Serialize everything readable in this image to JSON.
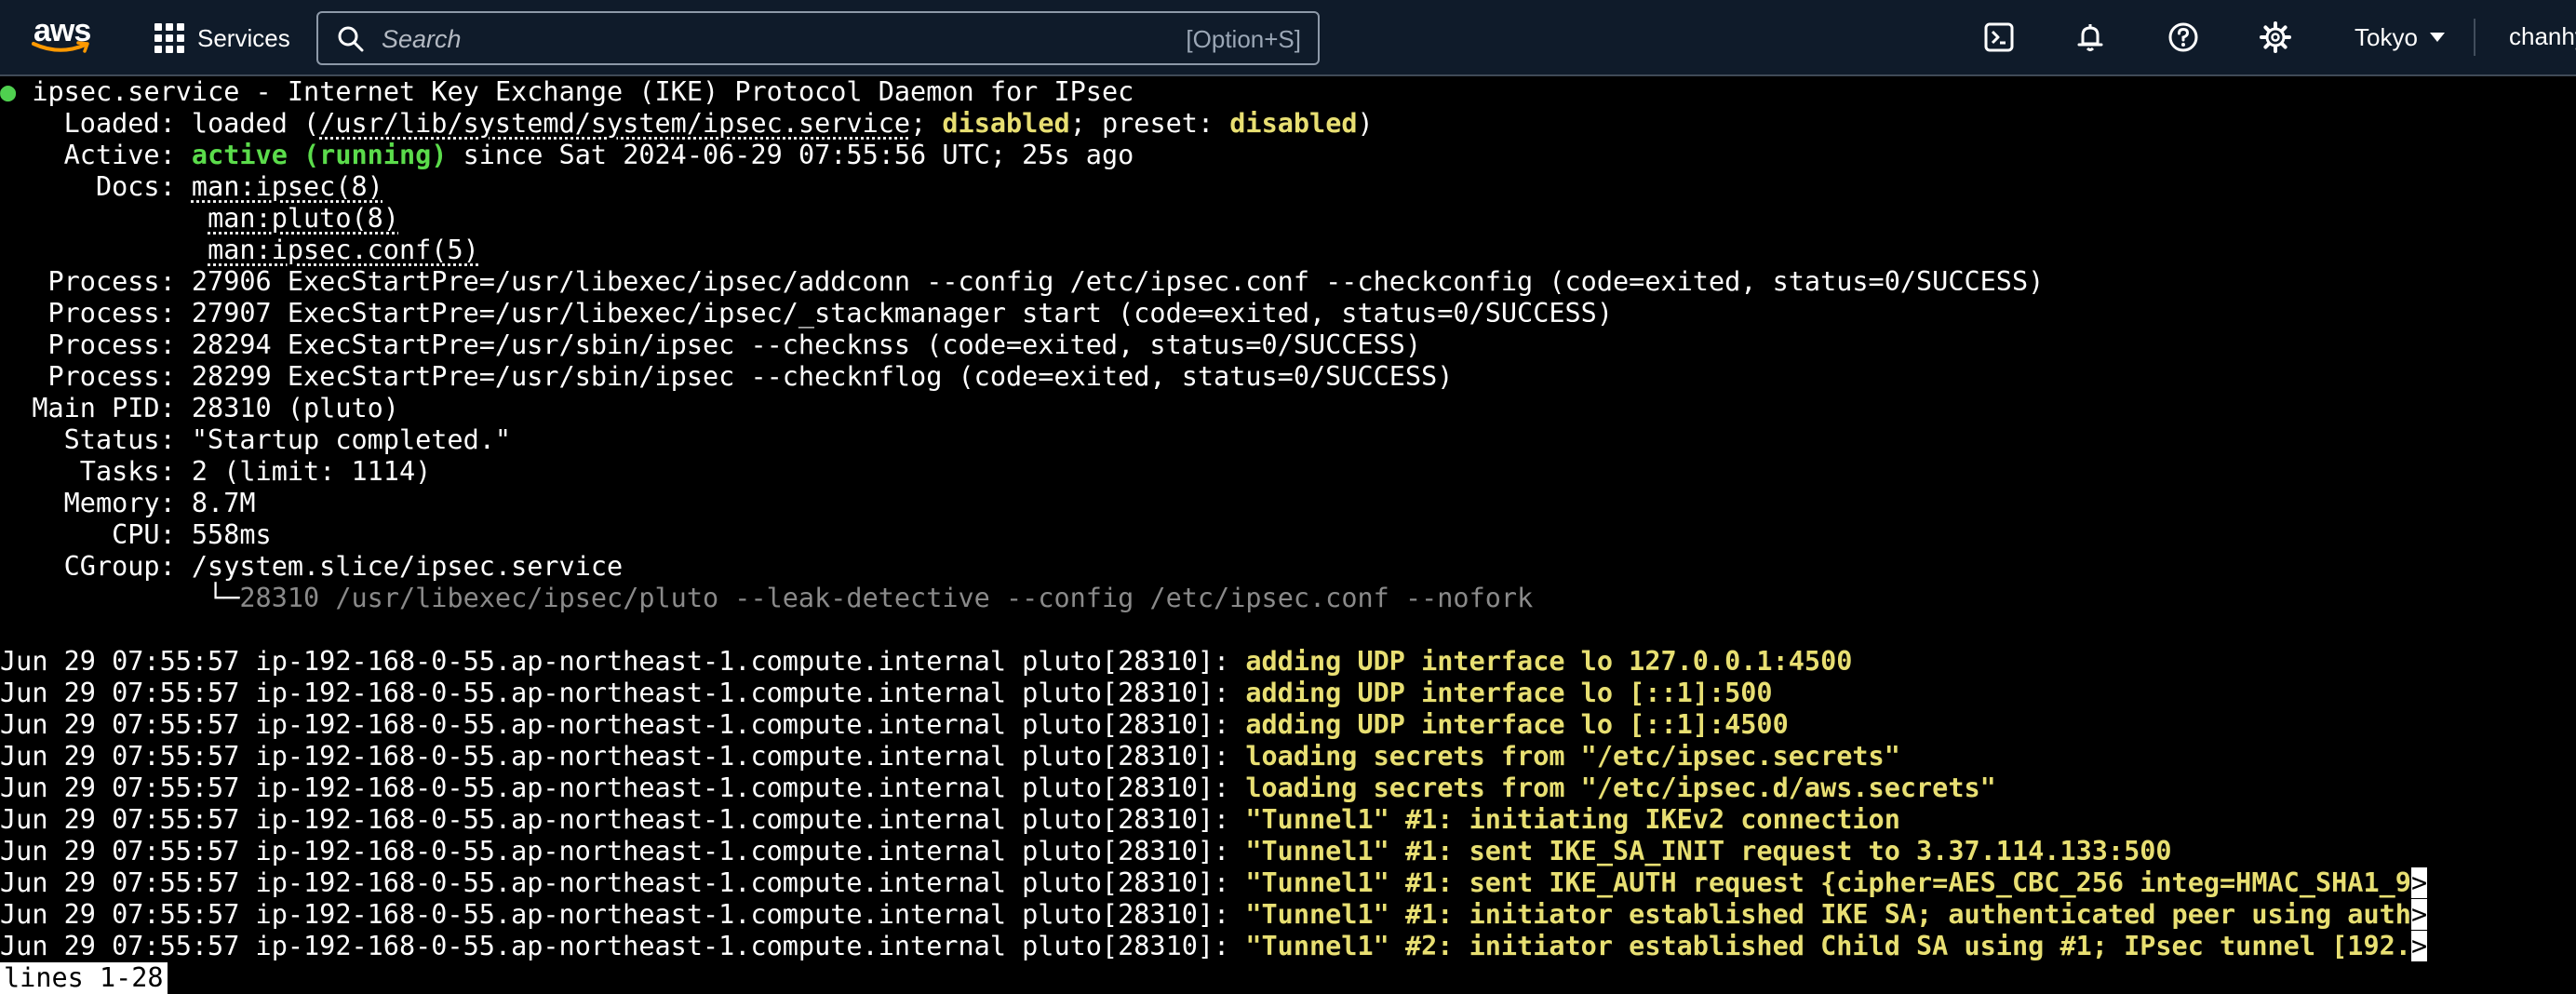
{
  "topnav": {
    "logo_text": "aws",
    "services_label": "Services",
    "search_placeholder": "Search",
    "search_shortcut": "[Option+S]",
    "region": "Tokyo",
    "account": "chanhy"
  },
  "terminal": {
    "unit": {
      "bullet": "●",
      "name": "ipsec.service - Internet Key Exchange (IKE) Protocol Daemon for IPsec",
      "loaded_label": "    Loaded: ",
      "loaded_state": "loaded (",
      "loaded_path": "/usr/lib/systemd/system/ipsec.service",
      "loaded_sep": "; ",
      "loaded_disabled": "disabled",
      "loaded_preset": "; preset: ",
      "loaded_preset_value": "disabled",
      "loaded_close": ")",
      "active_label": "    Active: ",
      "active_state": "active (running)",
      "active_rest": " since Sat 2024-06-29 07:55:56 UTC; 25s ago",
      "docs_label": "      Docs: ",
      "docs_indent": "             ",
      "docs": [
        "man:ipsec(8)",
        "man:pluto(8)",
        "man:ipsec.conf(5)"
      ],
      "processes": [
        "   Process: 27906 ExecStartPre=/usr/libexec/ipsec/addconn --config /etc/ipsec.conf --checkconfig (code=exited, status=0/SUCCESS)",
        "   Process: 27907 ExecStartPre=/usr/libexec/ipsec/_stackmanager start (code=exited, status=0/SUCCESS)",
        "   Process: 28294 ExecStartPre=/usr/sbin/ipsec --checknss (code=exited, status=0/SUCCESS)",
        "   Process: 28299 ExecStartPre=/usr/sbin/ipsec --checknflog (code=exited, status=0/SUCCESS)"
      ],
      "main_pid": "  Main PID: 28310 (pluto)",
      "status": "    Status: \"Startup completed.\"",
      "tasks": "     Tasks: 2 (limit: 1114)",
      "memory": "    Memory: 8.7M",
      "cpu": "       CPU: 558ms",
      "cgroup": "    CGroup: /system.slice/ipsec.service",
      "cgroup_tree_prefix": "             └─",
      "cgroup_tree": "28310 /usr/libexec/ipsec/pluto --leak-detective --config /etc/ipsec.conf --nofork"
    },
    "log_prefix": "Jun 29 07:55:57 ip-192-168-0-55.ap-northeast-1.compute.internal pluto[28310]: ",
    "log_messages": [
      "adding UDP interface lo 127.0.0.1:4500",
      "adding UDP interface lo [::1]:500",
      "adding UDP interface lo [::1]:4500",
      "loading secrets from \"/etc/ipsec.secrets\"",
      "loading secrets from \"/etc/ipsec.d/aws.secrets\"",
      "\"Tunnel1\" #1: initiating IKEv2 connection",
      "\"Tunnel1\" #1: sent IKE_SA_INIT request to 3.37.114.133:500",
      "\"Tunnel1\" #1: sent IKE_AUTH request {cipher=AES_CBC_256 integ=HMAC_SHA1_9",
      "\"Tunnel1\" #1: initiator established IKE SA; authenticated peer using auth",
      "\"Tunnel1\" #2: initiator established Child SA using #1; IPsec tunnel [192."
    ],
    "truncation_marker": ">",
    "pager_status": "lines 1-28"
  },
  "colors": {
    "nav_bg": "#0f1b2a",
    "active_green": "#5bdc4b",
    "highlight_yellow": "#e8df72",
    "dim_gray": "#8a8a8a"
  }
}
